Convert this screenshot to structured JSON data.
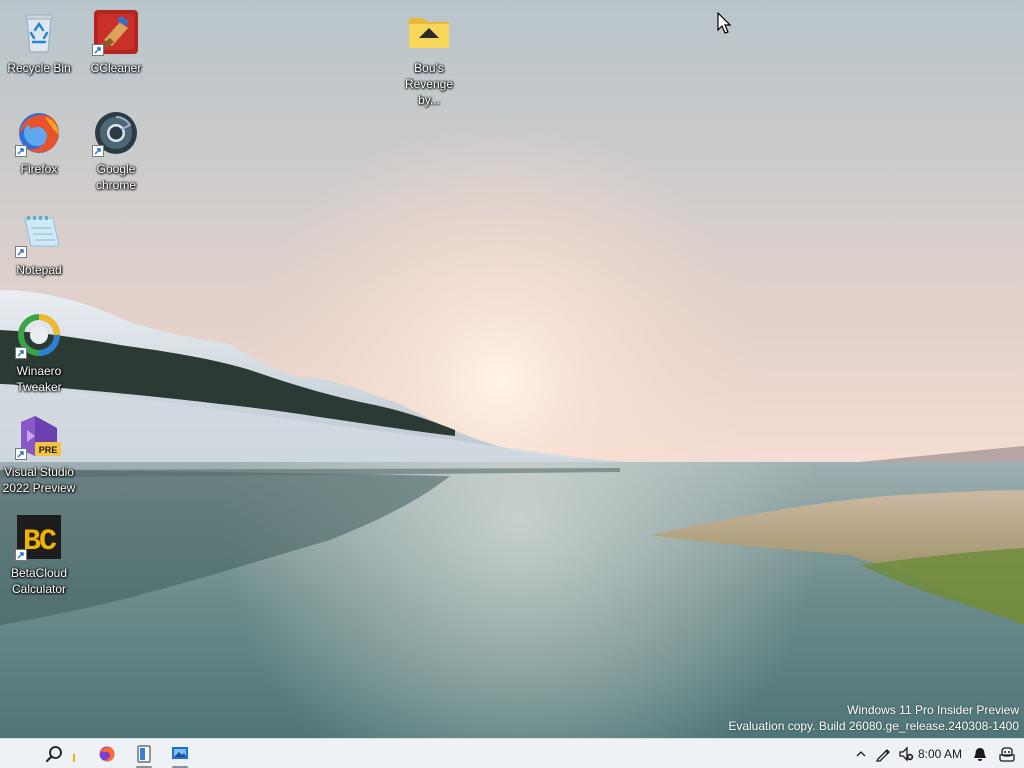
{
  "desktop": {
    "icons": [
      {
        "label": "Recycle Bin",
        "icon": "recycle-bin-icon"
      },
      {
        "label": "CCleaner",
        "icon": "ccleaner-icon"
      },
      {
        "label": "Bou's Revenge by...",
        "icon": "folder-icon"
      },
      {
        "label": "Firefox",
        "icon": "firefox-icon"
      },
      {
        "label": "Google chrome",
        "icon": "chrome-icon"
      },
      {
        "label": "Notepad",
        "icon": "notepad-icon"
      },
      {
        "label": "Winaero Tweaker",
        "icon": "winaero-tweaker-icon"
      },
      {
        "label": "Visual Studio 2022 Preview",
        "icon": "visual-studio-icon",
        "badge": "PRE"
      },
      {
        "label": "BetaCloud Calculator",
        "icon": "betacloud-calculator-icon",
        "glyph_text": "BC"
      }
    ]
  },
  "watermark": {
    "line1": "Windows 11 Pro Insider Preview",
    "line2": "Evaluation copy. Build 26080.ge_release.240308-1400"
  },
  "taskbar": {
    "apps": [
      "search-icon",
      "firefox-icon",
      "file-explorer-icon",
      "remote-desktop-icon"
    ],
    "tray": {
      "clock": "8:00 AM",
      "icons": [
        "chevron-up-icon",
        "pen-icon",
        "speaker-muted-icon",
        "bell-icon",
        "copilot-icon"
      ]
    }
  },
  "colors": {
    "taskbar_bg": "#eef1f5",
    "sky_top": "#b9c6cc",
    "sky_glow": "#f3d9cd",
    "water": "#5f8686"
  }
}
